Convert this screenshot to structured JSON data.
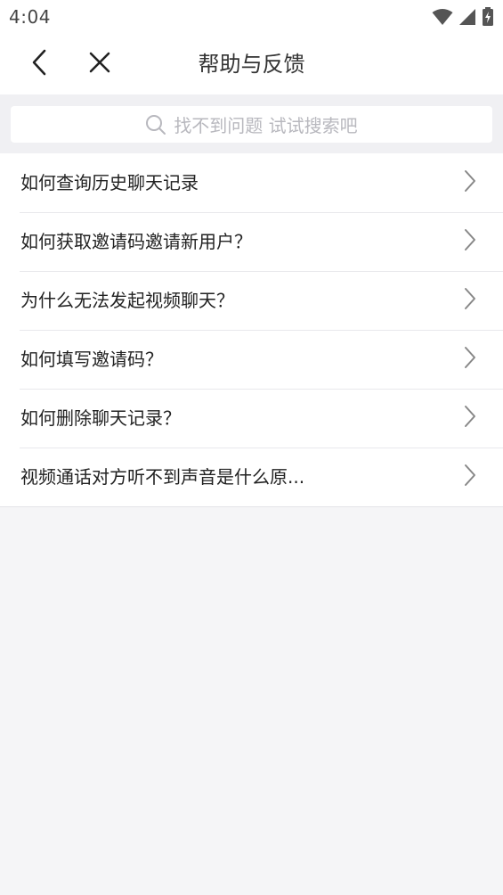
{
  "status_bar": {
    "time": "4:04",
    "icons": [
      "wifi-icon",
      "cell-signal-icon",
      "battery-charging-icon"
    ]
  },
  "header": {
    "back_icon": "chevron-left-icon",
    "close_icon": "close-icon",
    "title": "帮助与反馈"
  },
  "search": {
    "icon": "search-icon",
    "placeholder": "找不到问题 试试搜索吧"
  },
  "faq": {
    "items": [
      {
        "label": "如何查询历史聊天记录"
      },
      {
        "label": "如何获取邀请码邀请新用户？"
      },
      {
        "label": "为什么无法发起视频聊天？"
      },
      {
        "label": "如何填写邀请码？"
      },
      {
        "label": "如何删除聊天记录？"
      },
      {
        "label": "视频通话对方听不到声音是什么原..."
      }
    ]
  },
  "colors": {
    "page_background": "#f5f5f7",
    "card_background": "#ffffff",
    "text_primary": "#222222",
    "text_placeholder": "#b8b8be",
    "chevron": "#888888"
  }
}
